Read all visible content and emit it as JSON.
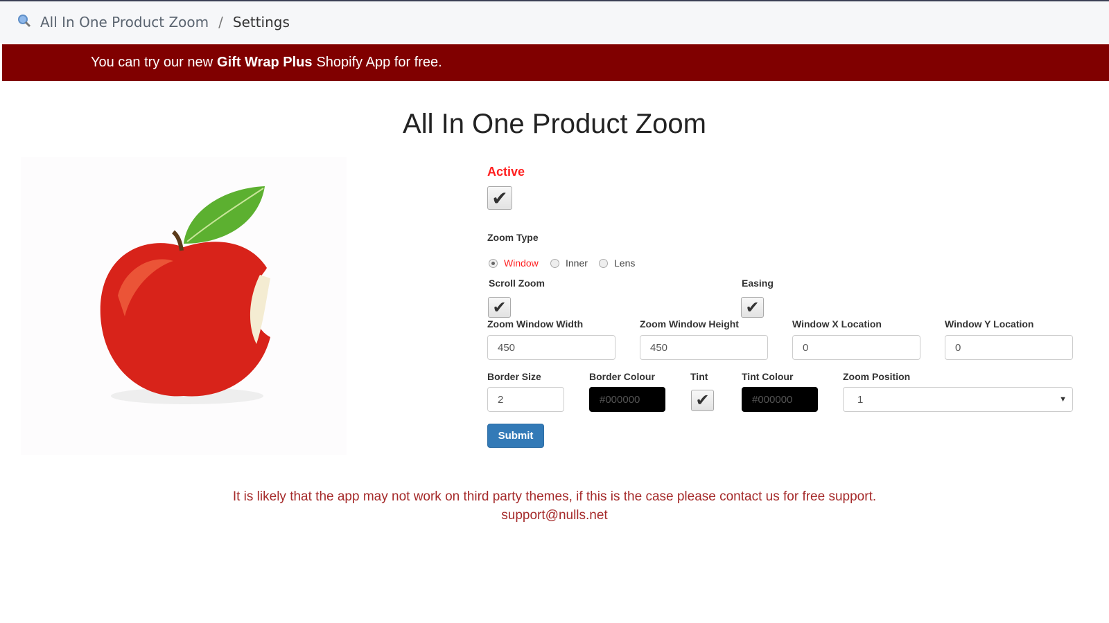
{
  "breadcrumb": {
    "app": "All In One Product Zoom",
    "separator": "/",
    "current": "Settings"
  },
  "banner": {
    "prefix": "You can try our new",
    "highlight": "Gift Wrap Plus",
    "suffix": "Shopify App for free.",
    "color": "#800000"
  },
  "title": "All In One Product Zoom",
  "form": {
    "active_label": "Active",
    "active_checked": true,
    "zoom_type_label": "Zoom Type",
    "zoom_types": [
      {
        "label": "Window",
        "selected": true
      },
      {
        "label": "Inner",
        "selected": false
      },
      {
        "label": "Lens",
        "selected": false
      }
    ],
    "scroll_zoom_label": "Scroll Zoom",
    "scroll_zoom_checked": true,
    "easing_label": "Easing",
    "easing_checked": true,
    "zoom_window_width_label": "Zoom Window Width",
    "zoom_window_width": "450",
    "zoom_window_height_label": "Zoom Window Height",
    "zoom_window_height": "450",
    "window_x_label": "Window X Location",
    "window_x": "0",
    "window_y_label": "Window Y Location",
    "window_y": "0",
    "border_size_label": "Border Size",
    "border_size": "2",
    "border_colour_label": "Border Colour",
    "border_colour": "#000000",
    "tint_label": "Tint",
    "tint_checked": true,
    "tint_colour_label": "Tint Colour",
    "tint_colour": "#000000",
    "zoom_position_label": "Zoom Position",
    "zoom_position": "1",
    "submit_label": "Submit"
  },
  "notice": {
    "text": "It is likely that the app may not work on third party themes, if this is the case please contact us for free support.",
    "email": "support@nulls.net"
  },
  "colors": {
    "accent": "#ff2020",
    "primary_button": "#337ab7"
  }
}
